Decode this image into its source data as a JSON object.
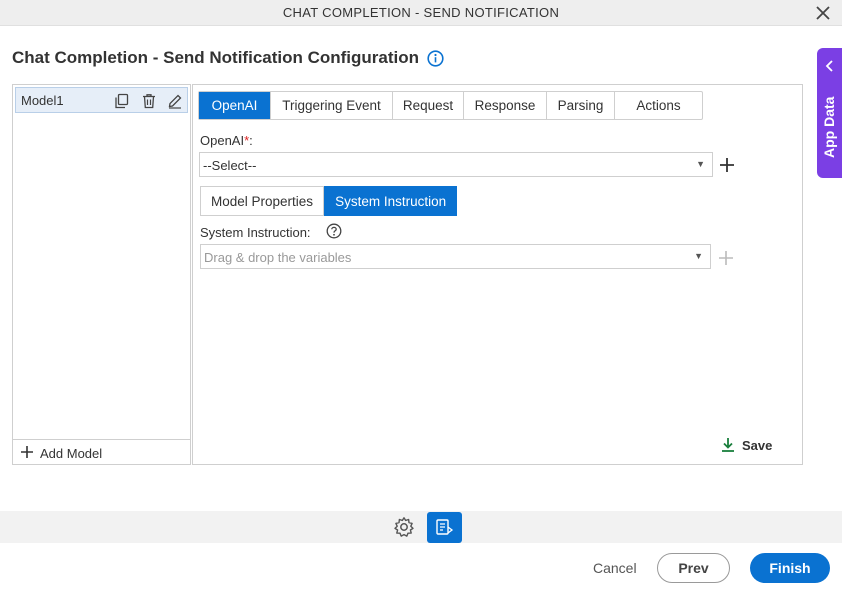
{
  "window": {
    "title": "CHAT COMPLETION - SEND NOTIFICATION"
  },
  "page": {
    "title": "Chat Completion - Send Notification Configuration"
  },
  "app_data_tab": {
    "label": "App Data"
  },
  "models": {
    "items": [
      {
        "name": "Model1"
      }
    ],
    "add_label": "Add Model"
  },
  "tabs": [
    {
      "label": "OpenAI",
      "active": true
    },
    {
      "label": "Triggering Event",
      "active": false
    },
    {
      "label": "Request",
      "active": false
    },
    {
      "label": "Response",
      "active": false
    },
    {
      "label": "Parsing",
      "active": false
    },
    {
      "label": "Actions",
      "active": false
    }
  ],
  "openai_field": {
    "label": "OpenAI",
    "required_mark": "*",
    "colon": ":",
    "value": "--Select--"
  },
  "subtabs": [
    {
      "label": "Model Properties",
      "active": false
    },
    {
      "label": "System Instruction",
      "active": true
    }
  ],
  "system_instruction": {
    "label": "System Instruction:",
    "placeholder": "Drag & drop the variables"
  },
  "save_label": "Save",
  "footer": {
    "cancel": "Cancel",
    "prev": "Prev",
    "finish": "Finish"
  },
  "colors": {
    "accent": "#0a72d1",
    "app_data": "#7b3fe4",
    "required": "#dd2222",
    "save_icon": "#1a7f3c"
  }
}
